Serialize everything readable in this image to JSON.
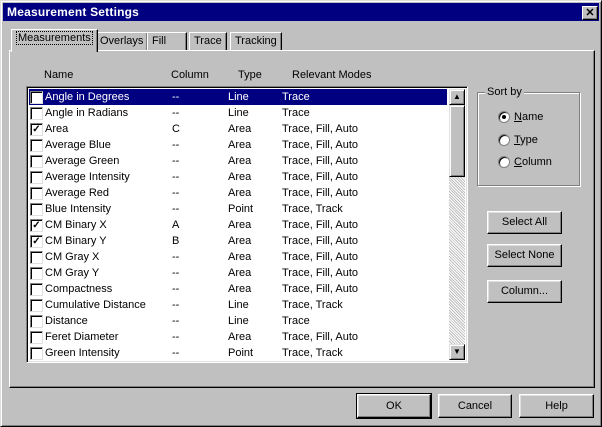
{
  "window": {
    "title": "Measurement Settings",
    "close": "✕"
  },
  "tabs": [
    {
      "label": "Measurements",
      "active": true
    },
    {
      "label": "Overlays",
      "active": false
    },
    {
      "label": "Fill",
      "active": false
    },
    {
      "label": "Trace",
      "active": false
    },
    {
      "label": "Tracking",
      "active": false
    }
  ],
  "list": {
    "headers": {
      "name": "Name",
      "column": "Column",
      "type": "Type",
      "modes": "Relevant Modes"
    },
    "rows": [
      {
        "checked": false,
        "name": "Angle in Degrees",
        "column": "--",
        "type": "Line",
        "modes": "Trace",
        "selected": true
      },
      {
        "checked": false,
        "name": "Angle in Radians",
        "column": "--",
        "type": "Line",
        "modes": "Trace"
      },
      {
        "checked": true,
        "name": "Area",
        "column": "C",
        "type": "Area",
        "modes": "Trace, Fill, Auto"
      },
      {
        "checked": false,
        "name": "Average Blue",
        "column": "--",
        "type": "Area",
        "modes": "Trace, Fill, Auto"
      },
      {
        "checked": false,
        "name": "Average Green",
        "column": "--",
        "type": "Area",
        "modes": "Trace, Fill, Auto"
      },
      {
        "checked": false,
        "name": "Average Intensity",
        "column": "--",
        "type": "Area",
        "modes": "Trace, Fill, Auto"
      },
      {
        "checked": false,
        "name": "Average Red",
        "column": "--",
        "type": "Area",
        "modes": "Trace, Fill, Auto"
      },
      {
        "checked": false,
        "name": "Blue Intensity",
        "column": "--",
        "type": "Point",
        "modes": "Trace, Track"
      },
      {
        "checked": true,
        "name": "CM Binary X",
        "column": "A",
        "type": "Area",
        "modes": "Trace, Fill, Auto"
      },
      {
        "checked": true,
        "name": "CM Binary Y",
        "column": "B",
        "type": "Area",
        "modes": "Trace, Fill, Auto"
      },
      {
        "checked": false,
        "name": "CM Gray X",
        "column": "--",
        "type": "Area",
        "modes": "Trace, Fill, Auto"
      },
      {
        "checked": false,
        "name": "CM Gray Y",
        "column": "--",
        "type": "Area",
        "modes": "Trace, Fill, Auto"
      },
      {
        "checked": false,
        "name": "Compactness",
        "column": "--",
        "type": "Area",
        "modes": "Trace, Fill, Auto"
      },
      {
        "checked": false,
        "name": "Cumulative Distance",
        "column": "--",
        "type": "Line",
        "modes": "Trace, Track"
      },
      {
        "checked": false,
        "name": "Distance",
        "column": "--",
        "type": "Line",
        "modes": "Trace"
      },
      {
        "checked": false,
        "name": "Feret Diameter",
        "column": "--",
        "type": "Area",
        "modes": "Trace, Fill, Auto"
      },
      {
        "checked": false,
        "name": "Green Intensity",
        "column": "--",
        "type": "Point",
        "modes": "Trace, Track"
      }
    ]
  },
  "sort_by": {
    "title": "Sort by",
    "options": [
      {
        "label": "Name",
        "selected": true
      },
      {
        "label": "Type",
        "selected": false
      },
      {
        "label": "Column",
        "selected": false
      }
    ]
  },
  "side_buttons": {
    "select_all": "Select All",
    "select_none": "Select None",
    "column": "Column..."
  },
  "footer_buttons": {
    "ok": "OK",
    "cancel": "Cancel",
    "help": "Help"
  },
  "icons": {
    "checkmark": "check-icon",
    "scroll_up": "arrow-up-icon",
    "scroll_down": "arrow-down-icon"
  }
}
